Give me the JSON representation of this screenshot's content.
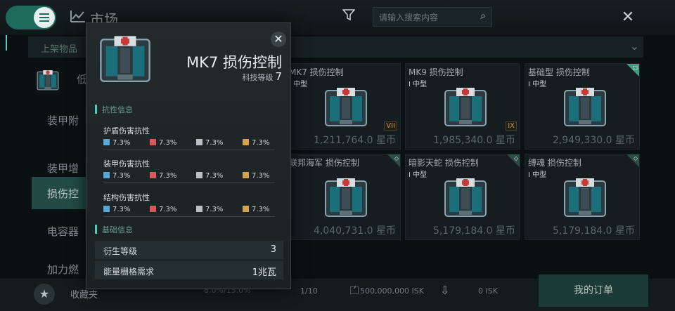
{
  "header": {
    "title": "市场",
    "search_placeholder": "请输入搜索内容"
  },
  "section": {
    "title": "上架物品"
  },
  "categories": [
    {
      "label": "低"
    },
    {
      "label": "装甲附"
    },
    {
      "label": "装甲增"
    },
    {
      "label": "损伤控"
    },
    {
      "label": "电容器"
    },
    {
      "label": "加力燃"
    }
  ],
  "items": [
    {
      "name": "MK7 损伤控制",
      "size": "中型",
      "level": "VII",
      "price": "1,211,764.0 星币"
    },
    {
      "name": "MK9 损伤控制",
      "size": "中型",
      "level": "IX",
      "price": "1,985,340.0 星币"
    },
    {
      "name": "基础型 损伤控制",
      "size": "中型",
      "level": "",
      "price": "2,949,330.0 星币"
    },
    {
      "name": "联邦海军 损伤控制",
      "size": "",
      "level": "",
      "price": "4,040,731.0 星币"
    },
    {
      "name": "暗影天蛇 损伤控制",
      "size": "中型",
      "level": "",
      "price": "5,179,184.0 星币"
    },
    {
      "name": "缚魂 损伤控制",
      "size": "中型",
      "level": "",
      "price": "5,179,184.0 星币"
    }
  ],
  "bottom": {
    "favorites": "收藏夹",
    "tax": "8.0%/15.0%",
    "page": "1/10",
    "wallet": "500,000,000 ISK",
    "order_amount": "0 ISK",
    "orders_button": "我的订单"
  },
  "popup": {
    "title": "MK7 损伤控制",
    "tech_label": "科技等级",
    "tech_value": "7",
    "resistance_header": "抗性信息",
    "resistances": [
      {
        "name": "护盾伤害抗性",
        "values": [
          "7.3%",
          "7.3%",
          "7.3%",
          "7.3%"
        ]
      },
      {
        "name": "装甲伤害抗性",
        "values": [
          "7.3%",
          "7.3%",
          "7.3%",
          "7.3%"
        ]
      },
      {
        "name": "结构伤害抗性",
        "values": [
          "7.3%",
          "7.3%",
          "7.3%",
          "7.3%"
        ]
      }
    ],
    "basic_header": "基础信息",
    "basic": [
      {
        "label": "衍生等级",
        "value": "3"
      },
      {
        "label": "能量栅格需求",
        "value": "1兆瓦"
      }
    ]
  },
  "colors": {
    "accent": "#48d0b5",
    "active_category": "#234a44",
    "em": "#5aa6d6",
    "thermal": "#d65a5a",
    "kinetic": "#b8c1c4",
    "explosive": "#d6a34a"
  }
}
